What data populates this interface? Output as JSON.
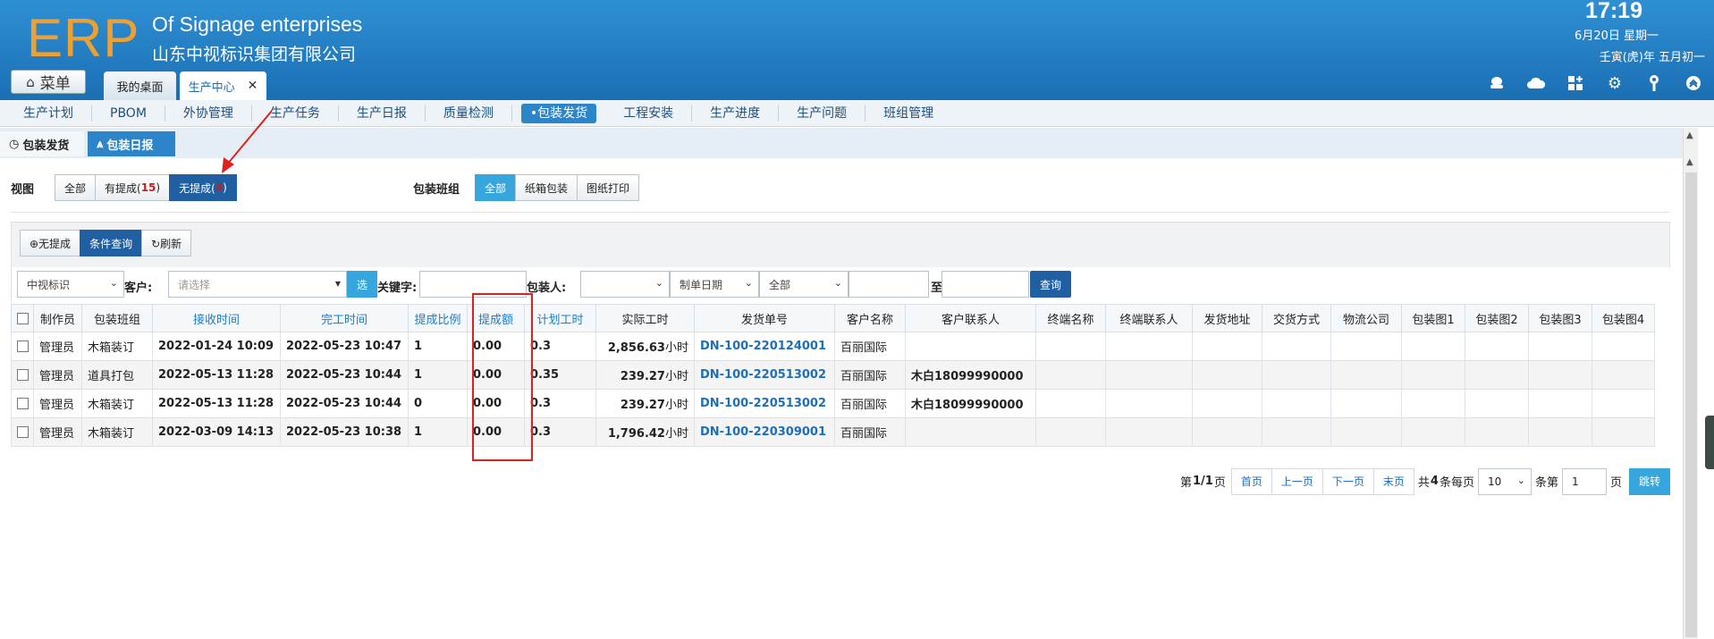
{
  "header": {
    "logo": "ERP",
    "brand_en": "Of Signage enterprises",
    "brand_cn": "山东中视标识集团有限公司",
    "time": "17:19",
    "date": "6月20日 星期一",
    "lunar": "壬寅(虎)年 五月初一",
    "menu_label": "菜单",
    "tabs": [
      {
        "label": "我的桌面"
      },
      {
        "label": "生产中心"
      }
    ],
    "icons": [
      "user-icon",
      "cloud-icon",
      "grid-add-icon",
      "gear-icon",
      "key-icon",
      "collapse-up-icon"
    ]
  },
  "subnav": {
    "items": [
      "生产计划",
      "PBOM",
      "外协管理",
      "生产任务",
      "生产日报",
      "质量检测",
      "•包装发货",
      "工程安装",
      "生产进度",
      "生产问题",
      "班组管理"
    ],
    "active_index": 6
  },
  "page_tabs": [
    {
      "label": "包装发货"
    },
    {
      "label": "包装日报"
    }
  ],
  "filters": {
    "view_label": "视图",
    "view_all": "全部",
    "view_has_prefix": "有提成(",
    "view_has_count": "15",
    "view_has_suffix": ")",
    "view_none_prefix": "无提成(",
    "view_none_count": "4",
    "view_none_suffix": ")",
    "team_label": "包装班组",
    "team_options": [
      "全部",
      "纸箱包装",
      "图纸打印"
    ]
  },
  "toolbar": {
    "no_commission": "⊕无提成",
    "condition_query": "条件查询",
    "refresh": "↻刷新"
  },
  "search": {
    "company": "中视标识",
    "customer_label": "客户:",
    "customer_placeholder": "请选择",
    "choose_btn": "选",
    "keyword_label": "关键字:",
    "packer_label": "包装人:",
    "date_type": "制单日期",
    "range": "全部",
    "to_label": "至",
    "query_btn": "查询"
  },
  "table": {
    "columns": [
      "制作员",
      "包装班组",
      "接收时间",
      "完工时间",
      "提成比例",
      "提成额",
      "计划工时",
      "实际工时",
      "发货单号",
      "客户名称",
      "客户联系人",
      "终端名称",
      "终端联系人",
      "发货地址",
      "交货方式",
      "物流公司",
      "包装图1",
      "包装图2",
      "包装图3",
      "包装图4"
    ],
    "rows": [
      {
        "maker": "管理员",
        "team": "木箱装订",
        "received": "2022-01-24 10:09",
        "finished": "2022-05-23 10:47",
        "ratio": "1",
        "amount": "0.00",
        "plan_hours": "0.3",
        "actual_hours": "2,856.63",
        "unit": "小时",
        "ship_no": "DN-100-220124001",
        "customer": "百丽国际",
        "contact": ""
      },
      {
        "maker": "管理员",
        "team": "道具打包",
        "received": "2022-05-13 11:28",
        "finished": "2022-05-23 10:44",
        "ratio": "1",
        "amount": "0.00",
        "plan_hours": "0.35",
        "actual_hours": "239.27",
        "unit": "小时",
        "ship_no": "DN-100-220513002",
        "customer": "百丽国际",
        "contact": "木白18099990000"
      },
      {
        "maker": "管理员",
        "team": "木箱装订",
        "received": "2022-05-13 11:28",
        "finished": "2022-05-23 10:44",
        "ratio": "0",
        "amount": "0.00",
        "plan_hours": "0.3",
        "actual_hours": "239.27",
        "unit": "小时",
        "ship_no": "DN-100-220513002",
        "customer": "百丽国际",
        "contact": "木白18099990000"
      },
      {
        "maker": "管理员",
        "team": "木箱装订",
        "received": "2022-03-09 14:13",
        "finished": "2022-05-23 10:38",
        "ratio": "1",
        "amount": "0.00",
        "plan_hours": "0.3",
        "actual_hours": "1,796.42",
        "unit": "小时",
        "ship_no": "DN-100-220309001",
        "customer": "百丽国际",
        "contact": ""
      }
    ]
  },
  "pager": {
    "page_info_prefix": "第",
    "page_info_value": "1/1",
    "page_info_suffix": "页",
    "first": "首页",
    "prev": "上一页",
    "next": "下一页",
    "last": "末页",
    "total_prefix": "共",
    "total_value": "4",
    "total_mid": "条每页",
    "page_size": "10",
    "page_size_suffix": "条第",
    "page_input": "1",
    "page_suffix": "页",
    "jump": "跳转"
  },
  "colors": {
    "header_blue": "#1b6fb3",
    "logo_orange": "#f0a030",
    "active_blue": "#1f5fa2",
    "light_blue": "#36a6dc",
    "annotation_red": "#e02020"
  }
}
